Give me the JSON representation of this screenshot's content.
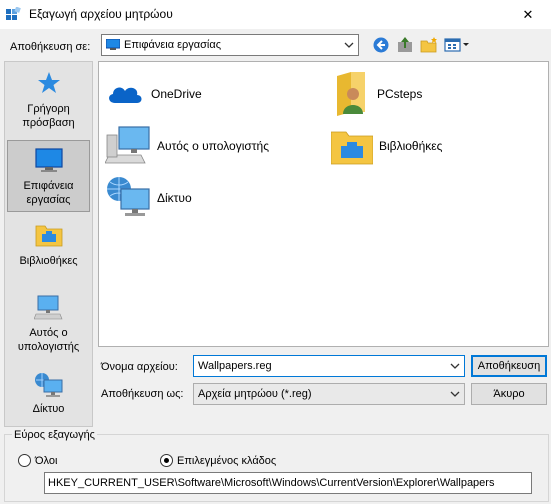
{
  "window": {
    "title": "Εξαγωγή αρχείου μητρώου",
    "close_glyph": "✕"
  },
  "toolbar": {
    "save_in_label": "Αποθήκευση σε:",
    "save_in_value": "Επιφάνεια εργασίας",
    "icons": [
      "back-icon",
      "up-folder-icon",
      "new-folder-icon",
      "view-menu-icon"
    ]
  },
  "places": [
    {
      "label": "Γρήγορη πρόσβαση",
      "icon": "quick-access-star-icon"
    },
    {
      "label": "Επιφάνεια εργασίας",
      "icon": "desktop-icon",
      "selected": true
    },
    {
      "label": "Βιβλιοθήκες",
      "icon": "libraries-icon"
    },
    {
      "label": "Αυτός ο υπολογιστής",
      "icon": "this-pc-icon"
    },
    {
      "label": "Δίκτυο",
      "icon": "network-icon"
    }
  ],
  "files": [
    {
      "label": "OneDrive",
      "icon": "onedrive-cloud-icon"
    },
    {
      "label": "PCsteps",
      "icon": "user-folder-icon"
    },
    {
      "label": "Αυτός ο υπολογιστής",
      "icon": "computer-icon"
    },
    {
      "label": "Βιβλιοθήκες",
      "icon": "libraries-folder-icon"
    },
    {
      "label": "Δίκτυο",
      "icon": "network-globe-icon"
    }
  ],
  "form": {
    "filename_label": "Όνομα αρχείου:",
    "filename_value": "Wallpapers.reg",
    "savetype_label": "Αποθήκευση ως:",
    "savetype_value": "Αρχεία μητρώου (*.reg)",
    "save_button": "Αποθήκευση",
    "cancel_button": "Άκυρο"
  },
  "export_range": {
    "title": "Εύρος εξαγωγής",
    "all_label": "Όλοι",
    "selected_branch_label": "Επιλεγμένος κλάδος",
    "selected": "selected_branch",
    "key_path": "HKEY_CURRENT_USER\\Software\\Microsoft\\Windows\\CurrentVersion\\Explorer\\Wallpapers"
  },
  "colors": {
    "accent": "#0078d7",
    "folder_yellow": "#f4c542",
    "cloud_blue": "#0a64c8"
  }
}
